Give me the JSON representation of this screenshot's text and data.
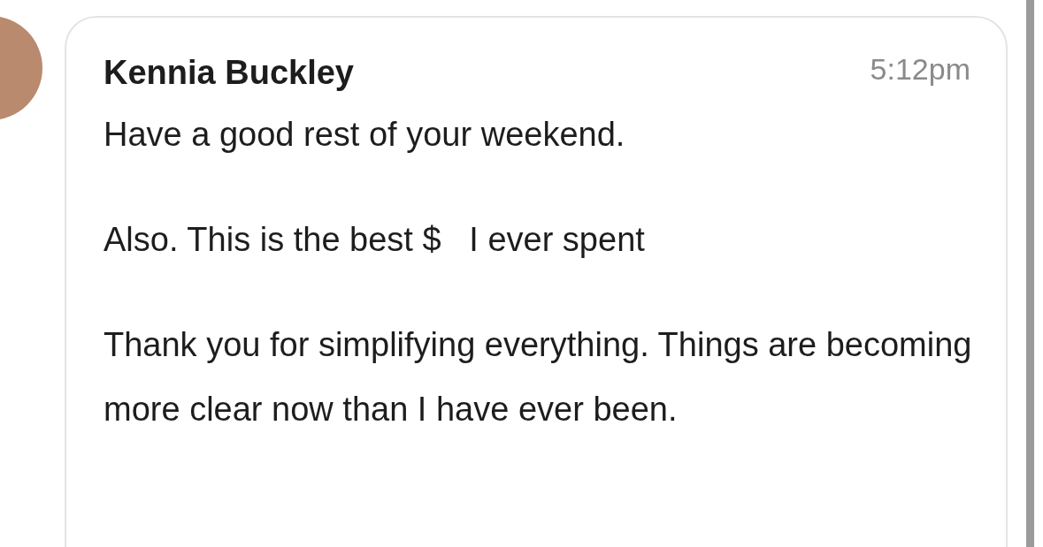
{
  "message": {
    "sender": "Kennia Buckley",
    "time": "5:12pm",
    "paragraphs": [
      "Have a good rest of your weekend.",
      "Also. This is the best $   I ever spent",
      "Thank you for simplifying everything. Things are becoming more clear now than I have ever been."
    ]
  }
}
